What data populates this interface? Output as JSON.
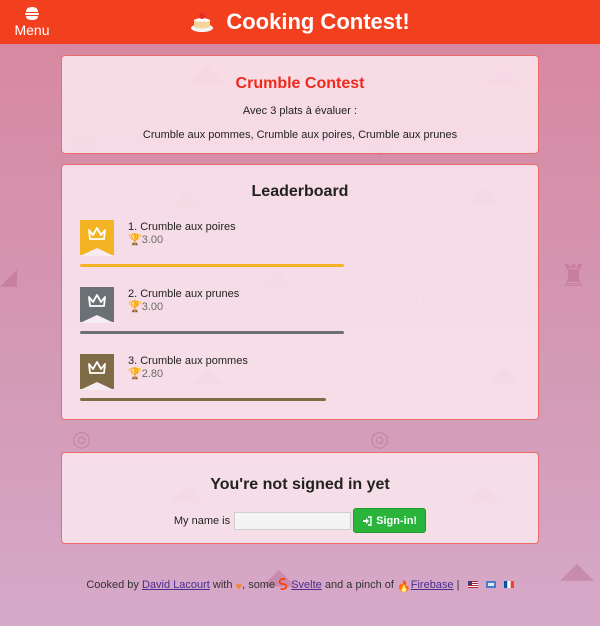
{
  "header": {
    "menu_label": "Menu",
    "title": "Cooking Contest!",
    "bar_color": "#f2401f"
  },
  "contest": {
    "title": "Crumble Contest",
    "subtitle": "Avec 3 plats à évaluer :",
    "plates": "Crumble aux pommes, Crumble aux poires, Crumble aux prunes"
  },
  "leaderboard": {
    "title": "Leaderboard",
    "entries": [
      {
        "label": "1. Crumble aux poires",
        "score": "3.00",
        "score_value": 3.0,
        "color": "#f4b322"
      },
      {
        "label": "2. Crumble aux prunes",
        "score": "3.00",
        "score_value": 3.0,
        "color": "#6b7074"
      },
      {
        "label": "3. Crumble aux pommes",
        "score": "2.80",
        "score_value": 2.8,
        "color": "#7f6c47"
      }
    ],
    "max_score": 3.0
  },
  "signin": {
    "title": "You're not signed in yet",
    "name_label": "My name is",
    "name_value": "",
    "button_label": "Sign-in!",
    "button_color": "#2ab43c"
  },
  "footer": {
    "cooked_by": "Cooked by",
    "author": "David Lacourt",
    "with": "with",
    "some": ", some",
    "svelte": "Svelte",
    "pinch": "and a pinch of",
    "firebase": "Firebase",
    "separator": "|",
    "languages": [
      "en",
      "other",
      "fr"
    ]
  },
  "icons": [
    "burger-icon",
    "cake-icon",
    "crown-icon",
    "trophy-icon",
    "sign-in-icon",
    "heart-icon",
    "svelte-icon",
    "fire-icon",
    "flag-icon"
  ]
}
